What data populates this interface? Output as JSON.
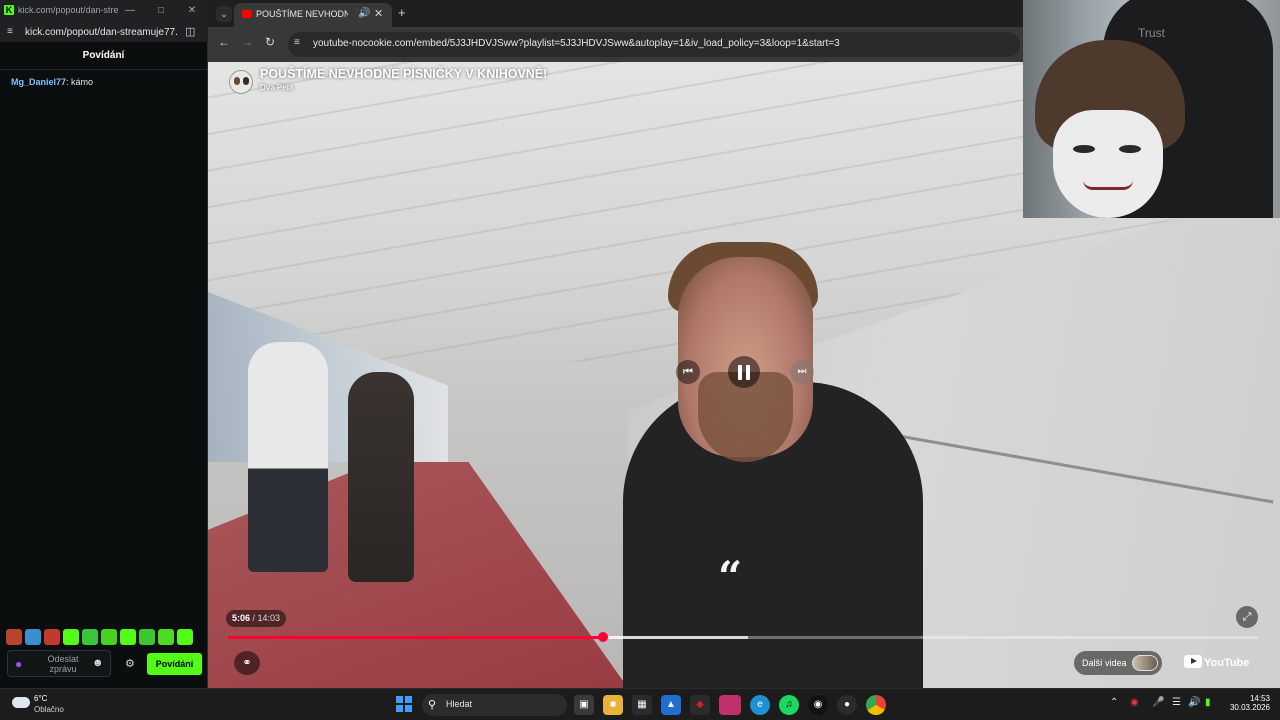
{
  "kick_window": {
    "title": "kick.com/popout/dan-stre...",
    "url": "kick.com/popout/dan-streamuje77...",
    "chat_header": "Povídání",
    "messages": [
      {
        "user": "Mg_Daniel77",
        "text": " kámo"
      }
    ],
    "composer_placeholder": "Odeslat zprávu",
    "send_label": "Povídání",
    "accent": "#53fc18"
  },
  "browser": {
    "tab_title": "POUŠTÍME NEVHODNÉ PÍS",
    "url": "youtube-nocookie.com/embed/5J3JHDVJSww?playlist=5J3JHDVJSww&autoplay=1&iv_load_policy=3&loop=1&start=3"
  },
  "video": {
    "title": "POUŠTÍME NEVHODNÉ PÍSNIČKY V KNIHOVNĚ!",
    "channel": "Dva Pela",
    "current_time": "5:06",
    "separator": " / ",
    "duration": "14:03",
    "progress_fraction": 0.364,
    "buffered_fraction": 0.505,
    "more_videos_label": "Další videa",
    "youtube_label": "YouTube",
    "progress_color": "#ff0033"
  },
  "webcam": {
    "chair_brand": "Trust"
  },
  "taskbar": {
    "weather_temp": "6°C",
    "weather_desc": "Oblačno",
    "search_placeholder": "Hledat",
    "time": "14:53",
    "date": "30.03.2026"
  }
}
